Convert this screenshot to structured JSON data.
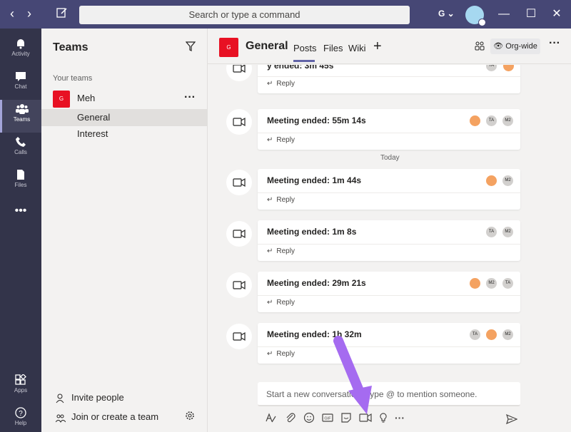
{
  "titlebar": {
    "search_placeholder": "Search or type a command",
    "tenant_initial": "G",
    "accent": "#464775"
  },
  "appbar": {
    "items": [
      {
        "label": "Activity",
        "icon": "bell-icon"
      },
      {
        "label": "Chat",
        "icon": "chat-icon"
      },
      {
        "label": "Teams",
        "icon": "teams-icon"
      },
      {
        "label": "Calls",
        "icon": "phone-icon"
      },
      {
        "label": "Files",
        "icon": "files-icon"
      },
      {
        "label": "Apps",
        "icon": "apps-icon"
      },
      {
        "label": "Help",
        "icon": "help-icon"
      }
    ]
  },
  "teams_panel": {
    "title": "Teams",
    "section_label": "Your teams",
    "team": {
      "initial": "G",
      "name": "Meh"
    },
    "channels": [
      "General",
      "Interest"
    ],
    "invite_label": "Invite people",
    "join_label": "Join or create a team"
  },
  "channel_header": {
    "initial": "G",
    "name": "General",
    "tabs": [
      "Posts",
      "Files",
      "Wiki"
    ],
    "orgwide_label": "Org-wide"
  },
  "feed": {
    "separator": "Today",
    "reply_label": "Reply",
    "messages": [
      {
        "title": "y ended: 3m 45s",
        "participants": [
          "TA",
          "img"
        ]
      },
      {
        "title": "Meeting ended: 55m 14s",
        "participants": [
          "img",
          "TA",
          "M2"
        ]
      },
      {
        "title": "Meeting ended: 1m 44s",
        "participants": [
          "img",
          "M2"
        ]
      },
      {
        "title": "Meeting ended: 1m 8s",
        "participants": [
          "TA",
          "M2"
        ]
      },
      {
        "title": "Meeting ended: 29m 21s",
        "participants": [
          "img",
          "M2",
          "TA"
        ]
      },
      {
        "title": "Meeting ended: 1h 32m",
        "participants": [
          "TA",
          "img",
          "M2"
        ]
      }
    ]
  },
  "composer": {
    "placeholder": "Start a new conversation. Type @ to mention someone."
  },
  "annotation": {
    "color": "#a56bf0"
  }
}
